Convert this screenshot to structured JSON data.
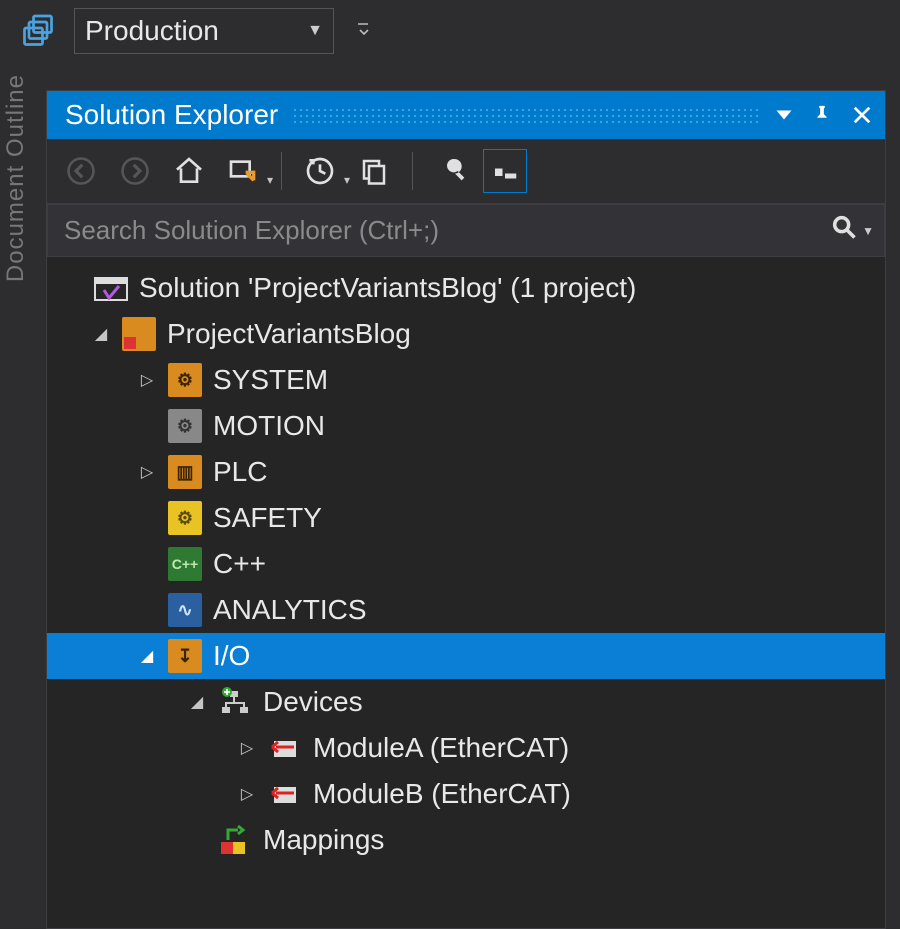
{
  "topbar": {
    "config_dropdown": "Production"
  },
  "sidebar_tab": "Document Outline",
  "panel": {
    "title": "Solution Explorer",
    "search_placeholder": "Search Solution Explorer (Ctrl+;)"
  },
  "tree": {
    "solution": "Solution 'ProjectVariantsBlog' (1 project)",
    "project": "ProjectVariantsBlog",
    "nodes": {
      "system": "SYSTEM",
      "motion": "MOTION",
      "plc": "PLC",
      "safety": "SAFETY",
      "cpp": "C++",
      "analytics": "ANALYTICS",
      "io": "I/O",
      "devices": "Devices",
      "moduleA": "ModuleA (EtherCAT)",
      "moduleB": "ModuleB (EtherCAT)",
      "mappings": "Mappings"
    }
  }
}
